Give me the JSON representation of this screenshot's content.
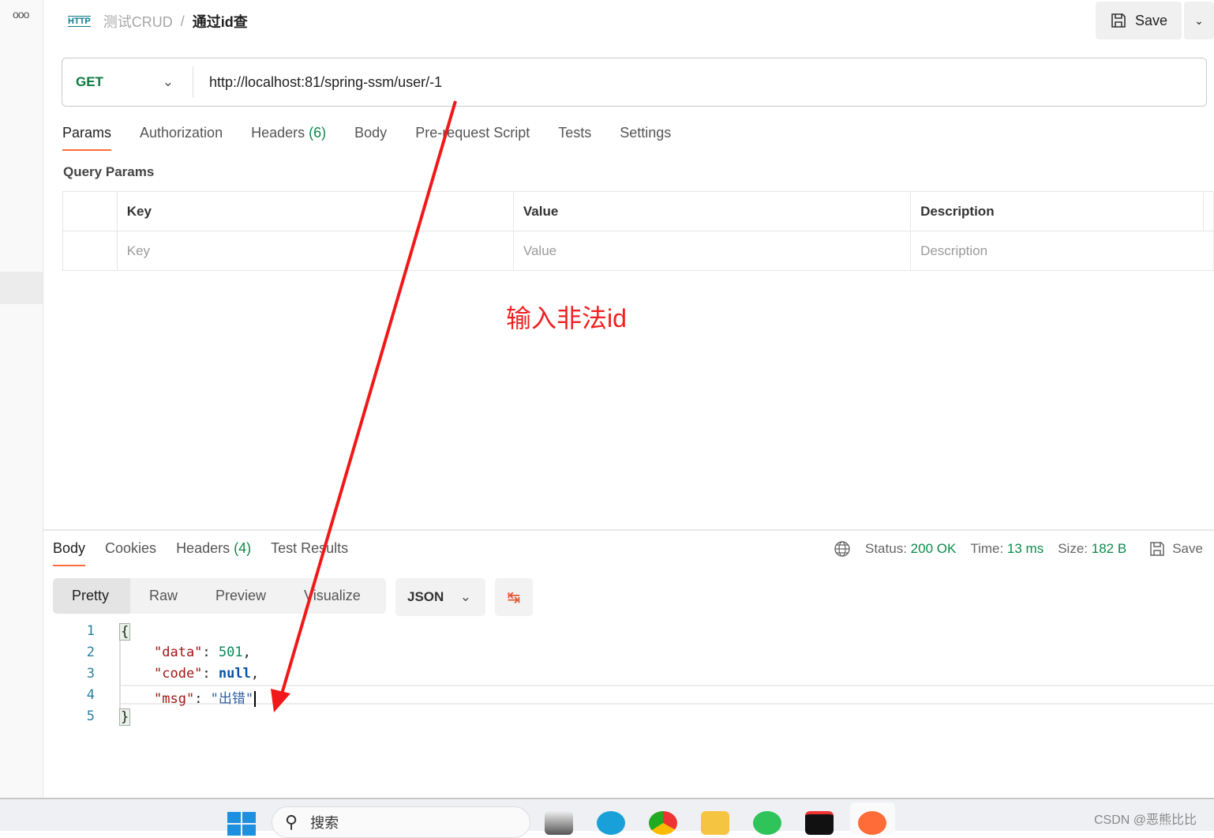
{
  "sidebar": {
    "more_icon": "ooo"
  },
  "header": {
    "protocol_badge": "HTTP",
    "collection": "测试CRUD",
    "separator": "/",
    "request_name": "通过id查",
    "save_label": "Save"
  },
  "request": {
    "method": "GET",
    "url": "http://localhost:81/spring-ssm/user/-1"
  },
  "tabs": [
    {
      "label": "Params"
    },
    {
      "label": "Authorization"
    },
    {
      "label": "Headers",
      "count": "(6)"
    },
    {
      "label": "Body"
    },
    {
      "label": "Pre-request Script"
    },
    {
      "label": "Tests"
    },
    {
      "label": "Settings"
    }
  ],
  "query_params": {
    "title": "Query Params",
    "headers": [
      "Key",
      "Value",
      "Description"
    ],
    "placeholders": [
      "Key",
      "Value",
      "Description"
    ]
  },
  "annotation": {
    "text": "输入非法id",
    "color": "#f02020"
  },
  "response": {
    "tabs": [
      {
        "label": "Body"
      },
      {
        "label": "Cookies"
      },
      {
        "label": "Headers",
        "count": "(4)"
      },
      {
        "label": "Test Results"
      }
    ],
    "status_label": "Status:",
    "status": "200 OK",
    "time_label": "Time:",
    "time": "13 ms",
    "size_label": "Size:",
    "size": "182 B",
    "save_label": "Save",
    "views": [
      "Pretty",
      "Raw",
      "Preview",
      "Visualize"
    ],
    "format": "JSON",
    "lines": [
      {
        "n": "1",
        "text": "{"
      },
      {
        "n": "2",
        "key": "\"data\"",
        "value": "501",
        "type": "num",
        "trail": ","
      },
      {
        "n": "3",
        "key": "\"code\"",
        "value": "null",
        "type": "kw",
        "trail": ","
      },
      {
        "n": "4",
        "key": "\"msg\"",
        "value": "\"出错\"",
        "type": "str",
        "trail": ""
      },
      {
        "n": "5",
        "text": "}"
      }
    ]
  },
  "taskbar": {
    "search_placeholder": "搜索",
    "watermark": "CSDN @恶熊比比"
  },
  "colors": {
    "accent": "#ff6c37",
    "method": "#0b7a3e",
    "status_ok": "#0b8a4a"
  }
}
